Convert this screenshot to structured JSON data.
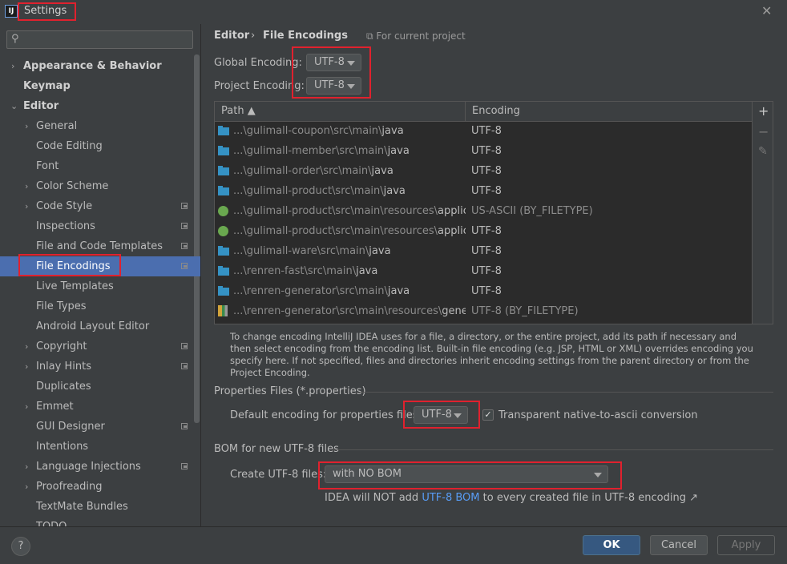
{
  "window": {
    "title": "Settings",
    "logo": "IJ"
  },
  "search": {
    "placeholder": ""
  },
  "sidebar": {
    "items": [
      {
        "label": "Appearance & Behavior",
        "arrow": "›"
      },
      {
        "label": "Keymap"
      },
      {
        "label": "Editor",
        "arrow": "⌄"
      },
      {
        "label": "General",
        "arrow": "›"
      },
      {
        "label": "Code Editing"
      },
      {
        "label": "Font"
      },
      {
        "label": "Color Scheme",
        "arrow": "›"
      },
      {
        "label": "Code Style",
        "arrow": "›"
      },
      {
        "label": "Inspections"
      },
      {
        "label": "File and Code Templates"
      },
      {
        "label": "File Encodings"
      },
      {
        "label": "Live Templates"
      },
      {
        "label": "File Types"
      },
      {
        "label": "Android Layout Editor"
      },
      {
        "label": "Copyright",
        "arrow": "›"
      },
      {
        "label": "Inlay Hints",
        "arrow": "›"
      },
      {
        "label": "Duplicates"
      },
      {
        "label": "Emmet",
        "arrow": "›"
      },
      {
        "label": "GUI Designer"
      },
      {
        "label": "Intentions"
      },
      {
        "label": "Language Injections",
        "arrow": "›"
      },
      {
        "label": "Proofreading",
        "arrow": "›"
      },
      {
        "label": "TextMate Bundles"
      },
      {
        "label": "TODO"
      }
    ]
  },
  "breadcrumb": {
    "parent": "Editor",
    "separator": "›",
    "current": "File Encodings",
    "scope": "For current project"
  },
  "encoding": {
    "global_label": "Global Encoding:",
    "global_value": "UTF-8",
    "project_label": "Project Encoding:",
    "project_value": "UTF-8"
  },
  "table": {
    "headers": {
      "path": "Path ▲",
      "encoding": "Encoding"
    },
    "rows": [
      {
        "icon": "folder-icon",
        "dim": "...\\gulimall-coupon\\src\\main\\",
        "hi": "java",
        "enc": "UTF-8"
      },
      {
        "icon": "folder-icon",
        "dim": "...\\gulimall-member\\src\\main\\",
        "hi": "java",
        "enc": "UTF-8"
      },
      {
        "icon": "folder-icon",
        "dim": "...\\gulimall-order\\src\\main\\",
        "hi": "java",
        "enc": "UTF-8"
      },
      {
        "icon": "folder-icon",
        "dim": "...\\gulimall-product\\src\\main\\",
        "hi": "java",
        "enc": "UTF-8"
      },
      {
        "icon": "spring-config-icon",
        "dim": "...\\gulimall-product\\src\\main\\resources\\",
        "hi": "applicatio",
        "enc": "US-ASCII (BY_FILETYPE)"
      },
      {
        "icon": "spring-config-icon",
        "dim": "...\\gulimall-product\\src\\main\\resources\\",
        "hi": "applicatio",
        "enc": "UTF-8"
      },
      {
        "icon": "folder-icon",
        "dim": "...\\gulimall-ware\\src\\main\\",
        "hi": "java",
        "enc": "UTF-8"
      },
      {
        "icon": "folder-icon",
        "dim": "...\\renren-fast\\src\\main\\",
        "hi": "java",
        "enc": "UTF-8"
      },
      {
        "icon": "folder-icon",
        "dim": "...\\renren-generator\\src\\main\\",
        "hi": "java",
        "enc": "UTF-8"
      },
      {
        "icon": "generator-file-icon",
        "dim": "...\\renren-generator\\src\\main\\resources\\",
        "hi": "generato",
        "enc": "UTF-8 (BY_FILETYPE)"
      }
    ],
    "tools": {
      "add": "+",
      "remove": "−",
      "edit": "✎"
    }
  },
  "help_text": "To change encoding IntelliJ IDEA uses for a file, a directory, or the entire project, add its path if necessary and then select encoding from the encoding list. Built-in file encoding (e.g. JSP, HTML or XML) overrides encoding you specify here. If not specified, files and directories inherit encoding settings from the parent directory or from the Project Encoding.",
  "properties": {
    "section": "Properties Files (*.properties)",
    "default_label": "Default encoding for properties files:",
    "default_value": "UTF-8",
    "native_ascii_label": "Transparent native-to-ascii conversion",
    "native_ascii_checked": true
  },
  "bom": {
    "section": "BOM for new UTF-8 files",
    "create_label": "Create UTF-8 files:",
    "create_value": "with NO BOM",
    "note_prefix": "IDEA will NOT add",
    "note_link": "UTF-8 BOM",
    "note_suffix": "to every created file in UTF-8 encoding ↗"
  },
  "footer": {
    "help": "?",
    "ok": "OK",
    "cancel": "Cancel",
    "apply": "Apply"
  },
  "colors": {
    "accent": "#4b6eaf",
    "highlight": "#e0212e",
    "link": "#589df6",
    "ok_button": "#365880"
  }
}
